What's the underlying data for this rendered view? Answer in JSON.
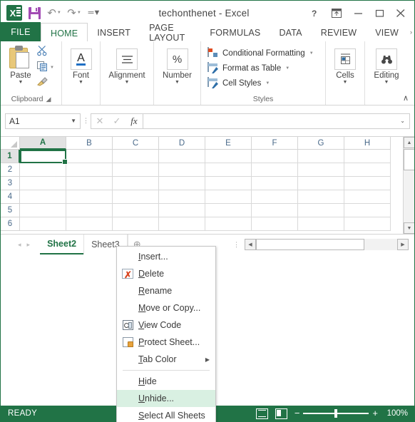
{
  "window": {
    "title": "techonthenet - Excel",
    "quick_access": [
      {
        "name": "save",
        "label": "Save"
      },
      {
        "name": "undo",
        "label": "Undo"
      },
      {
        "name": "redo",
        "label": "Redo"
      },
      {
        "name": "customize",
        "label": "Customize Quick Access Toolbar"
      }
    ],
    "controls": {
      "help": "?",
      "ribbon_display": "Ribbon Display Options",
      "minimize": "Minimize",
      "restore": "Restore Down",
      "close": "Close"
    }
  },
  "ribbon": {
    "file_tab": "FILE",
    "tabs": [
      {
        "label": "HOME",
        "active": true
      },
      {
        "label": "INSERT",
        "active": false
      },
      {
        "label": "PAGE LAYOUT",
        "active": false
      },
      {
        "label": "FORMULAS",
        "active": false
      },
      {
        "label": "DATA",
        "active": false
      },
      {
        "label": "REVIEW",
        "active": false
      },
      {
        "label": "VIEW",
        "active": false
      }
    ],
    "overflow": "›",
    "groups": {
      "clipboard": {
        "name": "Clipboard",
        "paste": "Paste",
        "cut": "Cut",
        "copy": "Copy",
        "format_painter": "Format Painter"
      },
      "font": {
        "name": "Font",
        "label": "Font"
      },
      "alignment": {
        "name": "Alignment",
        "label": "Alignment"
      },
      "number": {
        "name": "Number",
        "label": "Number",
        "symbol": "%"
      },
      "styles": {
        "name": "Styles",
        "items": [
          "Conditional Formatting",
          "Format as Table",
          "Cell Styles"
        ]
      },
      "cells": {
        "name": "Cells",
        "label": "Cells"
      },
      "editing": {
        "name": "Editing",
        "label": "Editing"
      }
    },
    "collapse": "∧"
  },
  "formula_bar": {
    "name_box_value": "A1",
    "cancel": "✕",
    "enter": "✓",
    "insert_function": "fx",
    "formula_value": "",
    "expand": "⌄"
  },
  "grid": {
    "columns": [
      "A",
      "B",
      "C",
      "D",
      "E",
      "F",
      "G",
      "H"
    ],
    "rows": [
      "1",
      "2",
      "3",
      "4",
      "5",
      "6"
    ],
    "selected_cell": "A1",
    "selected_column": "A",
    "selected_row": "1"
  },
  "sheet_tabs": {
    "prev": "◂",
    "next": "▸",
    "tabs": [
      {
        "label": "Sheet2",
        "active": true
      },
      {
        "label": "Sheet3",
        "active": false
      }
    ],
    "add_label": "⊕"
  },
  "status_bar": {
    "mode": "READY",
    "views": [
      "Normal",
      "Page Layout"
    ],
    "zoom_out": "−",
    "zoom_in": "+",
    "zoom_level": "100%"
  },
  "context_menu": {
    "items": [
      {
        "label": "Insert...",
        "mnemonic": "I",
        "icon": null,
        "highlighted": false,
        "submenu": false,
        "separator_after": false
      },
      {
        "label": "Delete",
        "mnemonic": "D",
        "icon": "delete-sheet-icon",
        "highlighted": false,
        "submenu": false,
        "separator_after": false
      },
      {
        "label": "Rename",
        "mnemonic": "R",
        "icon": null,
        "highlighted": false,
        "submenu": false,
        "separator_after": false
      },
      {
        "label": "Move or Copy...",
        "mnemonic": "M",
        "icon": null,
        "highlighted": false,
        "submenu": false,
        "separator_after": false
      },
      {
        "label": "View Code",
        "mnemonic": "V",
        "icon": "view-code-icon",
        "highlighted": false,
        "submenu": false,
        "separator_after": false
      },
      {
        "label": "Protect Sheet...",
        "mnemonic": "P",
        "icon": "protect-sheet-icon",
        "highlighted": false,
        "submenu": false,
        "separator_after": false
      },
      {
        "label": "Tab Color",
        "mnemonic": "T",
        "icon": null,
        "highlighted": false,
        "submenu": true,
        "separator_after": true
      },
      {
        "label": "Hide",
        "mnemonic": "H",
        "icon": null,
        "highlighted": false,
        "submenu": false,
        "separator_after": false
      },
      {
        "label": "Unhide...",
        "mnemonic": "U",
        "icon": null,
        "highlighted": true,
        "submenu": false,
        "separator_after": false
      },
      {
        "label": "Select All Sheets",
        "mnemonic": "S",
        "icon": null,
        "highlighted": false,
        "submenu": false,
        "separator_after": false
      }
    ],
    "submenu_arrow": "▶",
    "highlight_color": "#d9f0e2"
  },
  "colors": {
    "accent": "#217346",
    "titlebar_bg": "#ffffff",
    "ribbon_bg": "#ffffff",
    "statusbar_bg": "#217346"
  }
}
